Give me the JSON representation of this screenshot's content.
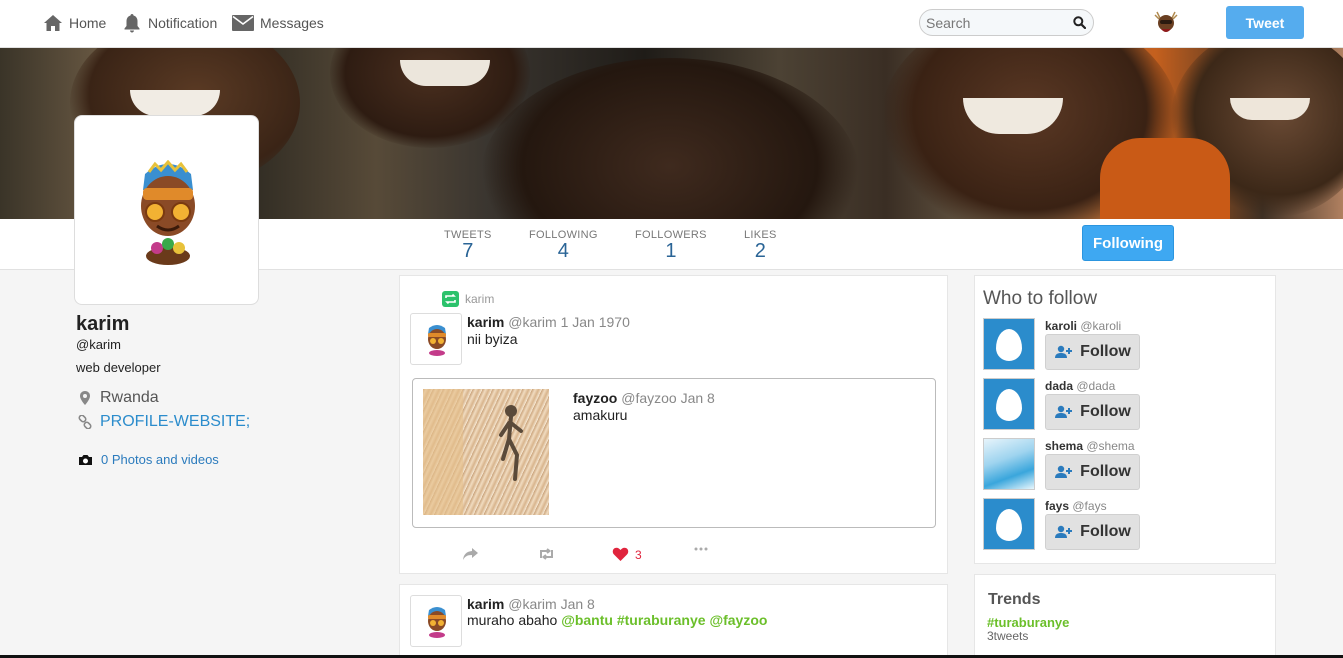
{
  "nav": {
    "home": "Home",
    "notification": "Notification",
    "messages": "Messages",
    "search_placeholder": "Search",
    "tweet_button": "Tweet"
  },
  "stats": {
    "tweets_label": "TWEETS",
    "tweets": "7",
    "following_label": "FOLLOWING",
    "following": "4",
    "followers_label": "FOLLOWERS",
    "followers": "1",
    "likes_label": "LIKES",
    "likes": "2",
    "following_button": "Following"
  },
  "profile": {
    "name": "karim",
    "handle": "@karim",
    "bio": "web developer",
    "location": "Rwanda",
    "website": "PROFILE-WEBSITE;",
    "photos": "0 Photos and videos"
  },
  "timeline": {
    "tweet1": {
      "retweeted_by": "karim",
      "name": "karim",
      "meta": "@karim 1 Jan 1970",
      "text": "nii byiza",
      "quote": {
        "name": "fayzoo",
        "meta": "@fayzoo Jan 8",
        "text": "amakuru"
      },
      "likes": "3"
    },
    "tweet2": {
      "name": "karim",
      "meta": "@karim Jan 8",
      "text": "muraho abaho",
      "tags": [
        "@bantu",
        "#turaburanye",
        "@fayzoo"
      ]
    }
  },
  "who_to_follow": {
    "title": "Who to follow",
    "follow_label": "Follow",
    "users": [
      {
        "name": "karoli",
        "handle": "@karoli"
      },
      {
        "name": "dada",
        "handle": "@dada"
      },
      {
        "name": "shema",
        "handle": "@shema"
      },
      {
        "name": "fays",
        "handle": "@fays"
      }
    ]
  },
  "trends": {
    "title": "Trends",
    "items": [
      {
        "tag": "#turaburanye",
        "count": "3tweets"
      }
    ]
  },
  "colors": {
    "accent": "#55acee",
    "link": "#2b8ccc",
    "hashtag": "#6bbf2a",
    "like": "#e0243d"
  }
}
